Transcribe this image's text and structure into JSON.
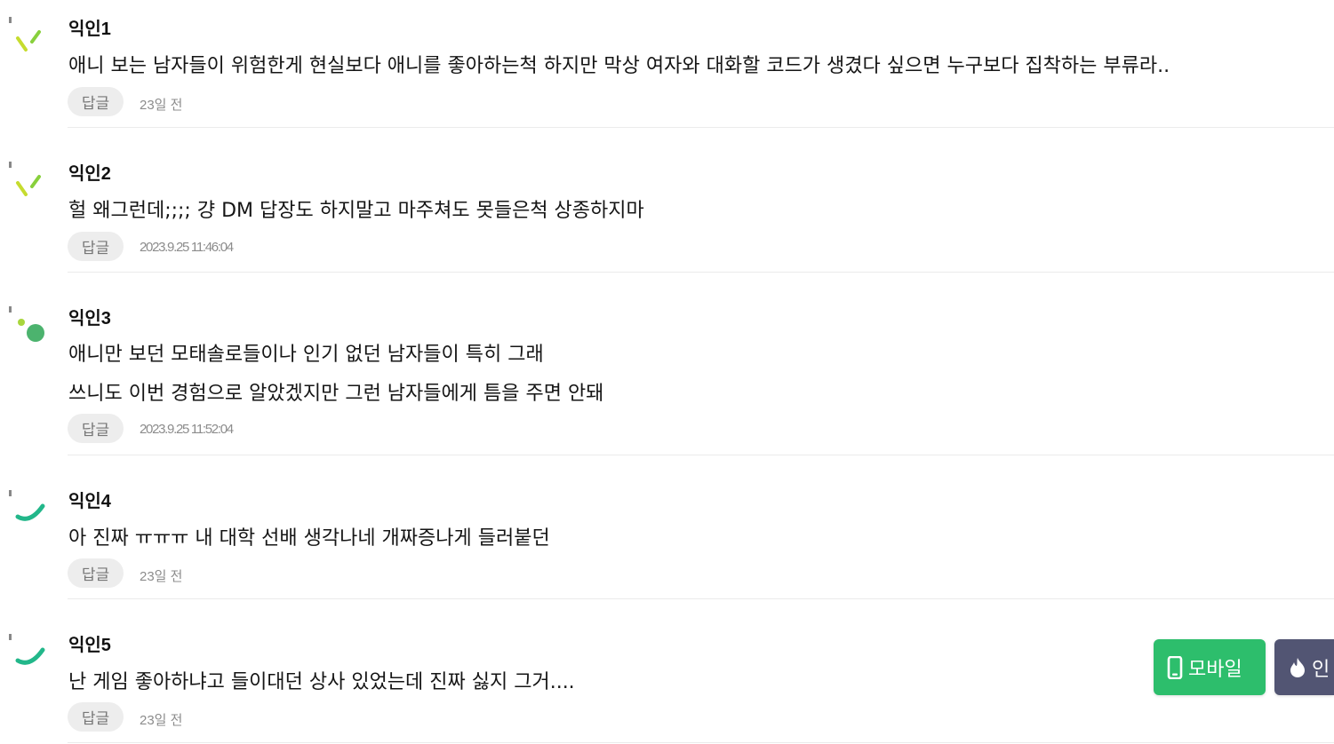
{
  "comments": [
    {
      "author": "익인1",
      "lines": [
        "애니 보는 남자들이 위험한게 현실보다 애니를 좋아하는척 하지만 막상 여자와 대화할 코드가 생겼다 싶으면 누구보다 집착하는 부류라.."
      ],
      "reply_label": "답글",
      "time": "23일 전",
      "avatar": "dash-lines"
    },
    {
      "author": "익인2",
      "lines": [
        "헐 왜그런데;;;; 걍 DM 답장도 하지말고 마주쳐도 못들은척 상종하지마"
      ],
      "reply_label": "답글",
      "time": "2023.9.25 11:46:04",
      "avatar": "dash-lines"
    },
    {
      "author": "익인3",
      "lines": [
        "애니만 보던 모태솔로들이나 인기 없던 남자들이 특히 그래",
        "쓰니도 이번 경험으로 알았겠지만 그런 남자들에게 틈을 주면 안돼"
      ],
      "reply_label": "답글",
      "time": "2023.9.25 11:52:04",
      "avatar": "dots"
    },
    {
      "author": "익인4",
      "lines": [
        "아 진짜 ㅠㅠㅠ 내 대학 선배 생각나네 개짜증나게 들러붙던"
      ],
      "reply_label": "답글",
      "time": "23일 전",
      "avatar": "arc"
    },
    {
      "author": "익인5",
      "lines": [
        "난 게임 좋아하냐고 들이대던 상사 있었는데 진짜 싫지 그거...."
      ],
      "reply_label": "답글",
      "time": "23일 전",
      "avatar": "arc"
    }
  ],
  "floating": {
    "mobile_label": "모바일",
    "mobile_icon": "smartphone-icon",
    "mobile_color": "#2dbe6c",
    "popular_label": "인",
    "popular_icon": "flame-icon",
    "popular_color": "#525573"
  }
}
